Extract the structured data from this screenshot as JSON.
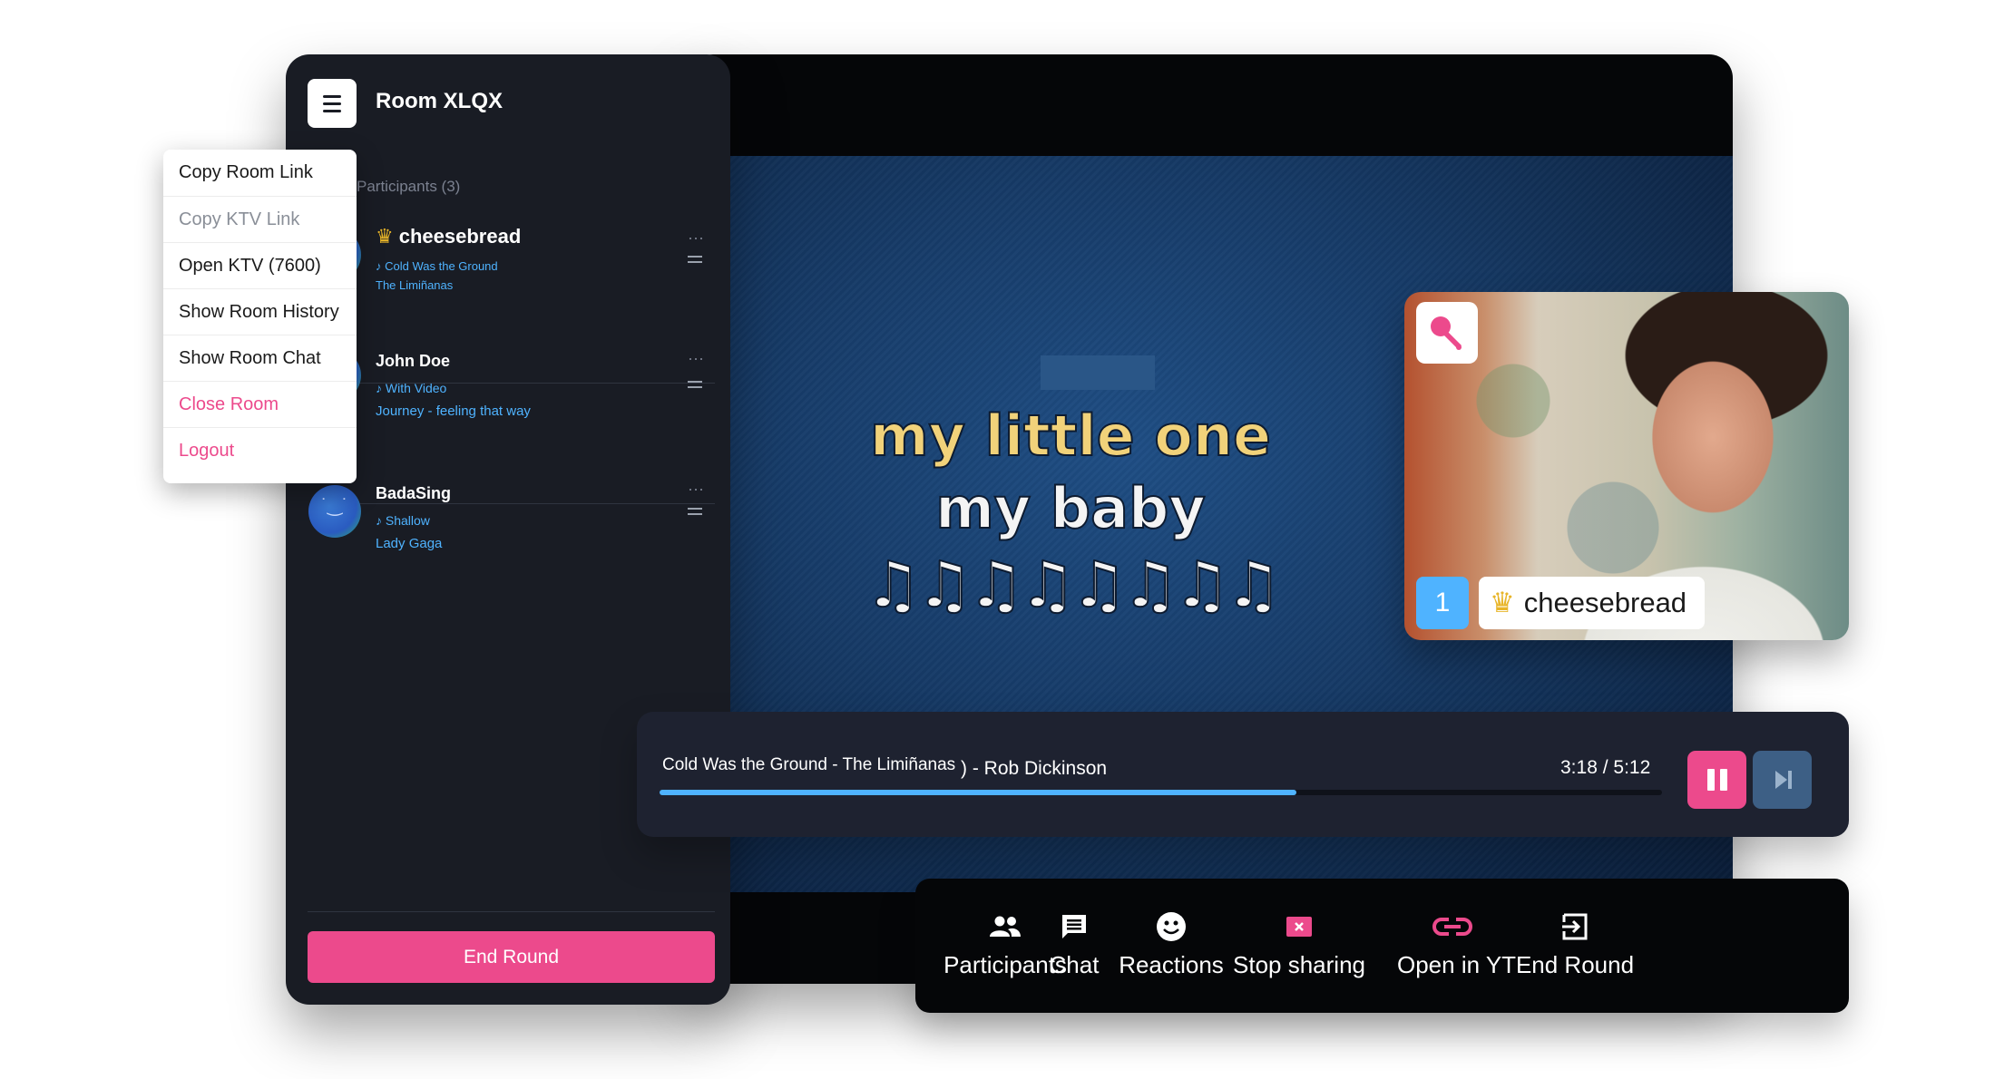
{
  "sidebar": {
    "room_title": "Room XLQX",
    "participants_heading": "Participants (3)",
    "participants": [
      {
        "name": "cheesebread",
        "is_host": true,
        "song": "Cold Was the Ground",
        "artist": "The Limiñanas"
      },
      {
        "name": "John Doe",
        "is_host": false,
        "song": "With Video",
        "artist": "Journey - feeling that way"
      },
      {
        "name": "BadaSing",
        "is_host": false,
        "song": "Shallow",
        "artist": "Lady Gaga"
      }
    ],
    "end_round_label": "End Round"
  },
  "menu": {
    "items": [
      {
        "label": "Copy Room Link",
        "style": "normal"
      },
      {
        "label": "Copy KTV Link",
        "style": "muted"
      },
      {
        "label": "Open KTV (7600)",
        "style": "normal"
      },
      {
        "label": "Show Room History",
        "style": "normal"
      },
      {
        "label": "Show Room Chat",
        "style": "normal"
      },
      {
        "label": "Close Room",
        "style": "danger"
      },
      {
        "label": "Logout",
        "style": "danger"
      }
    ]
  },
  "lyrics": {
    "line1": "my little one",
    "line2": "my baby",
    "line3": "♫♫♫♫♫♫♫♫"
  },
  "camera": {
    "rank": "1",
    "singer_name": "cheesebread",
    "icons": [
      "microphone-icon",
      "crown-icon"
    ]
  },
  "player": {
    "now_playing": "Cold Was the Ground - The Limiñanas",
    "artist_fragment": ") - Rob Dickinson",
    "elapsed": "3:18",
    "separator": "/",
    "duration": "5:12",
    "progress_fraction": 0.635
  },
  "toolbar": {
    "items": [
      {
        "label": "Participants",
        "icon": "people-icon"
      },
      {
        "label": "Chat",
        "icon": "chat-icon"
      },
      {
        "label": "Reactions",
        "icon": "smiley-icon"
      },
      {
        "label": "Stop sharing",
        "icon": "stop-share-icon"
      },
      {
        "label": "Open in YT",
        "icon": "link-icon"
      },
      {
        "label": "End Round",
        "icon": "exit-icon"
      }
    ]
  },
  "colors": {
    "accent_pink": "#ec4a8c",
    "accent_blue": "#4fb3ff",
    "panel_dark": "#191c24",
    "crown_gold": "#e8b529"
  }
}
